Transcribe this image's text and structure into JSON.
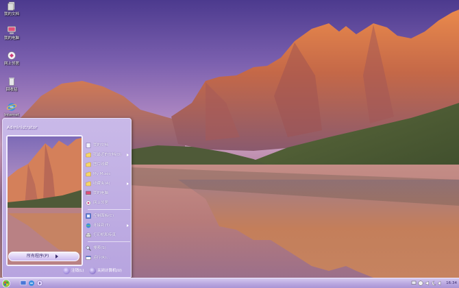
{
  "desktop": {
    "icons": [
      {
        "id": "my-documents",
        "label": "我的文档"
      },
      {
        "id": "my-computer",
        "label": "我的电脑"
      },
      {
        "id": "network-places",
        "label": "网上邻居"
      },
      {
        "id": "recycle-bin",
        "label": "回收站"
      },
      {
        "id": "internet-explorer",
        "label": "Internet"
      }
    ]
  },
  "start_menu": {
    "user_name": "Administrator",
    "all_programs_label": "所有程序(P)",
    "items": [
      {
        "label": "我的文档",
        "icon": "folder-docs-icon"
      },
      {
        "label": "我最近的文档(D)",
        "icon": "folder-recent-icon",
        "has_submenu": true
      },
      {
        "label": "图片收藏",
        "icon": "folder-pictures-icon"
      },
      {
        "label": "My Music",
        "icon": "folder-music-icon"
      },
      {
        "label": "收藏夹(A)",
        "icon": "folder-favorites-icon",
        "has_submenu": true
      },
      {
        "label": "我的电脑",
        "icon": "computer-icon"
      },
      {
        "label": "网上邻居",
        "icon": "network-icon"
      },
      {
        "label": "控制面板(C)",
        "icon": "control-panel-icon"
      },
      {
        "label": "连接到(T)",
        "icon": "connect-icon",
        "has_submenu": true
      },
      {
        "label": "打印机和传真",
        "icon": "printer-icon"
      },
      {
        "label": "搜索(S)",
        "icon": "search-icon"
      },
      {
        "label": "运行(R)...",
        "icon": "run-icon"
      }
    ],
    "footer": {
      "logoff_label": "注销(L)",
      "shutdown_label": "关闭计算机(U)"
    }
  },
  "taskbar": {
    "clock": "16:34"
  },
  "colors": {
    "menu_bg": "#c2b1e6",
    "taskbar_bg": "#b9a8e0",
    "text_dark": "#3a2a6e"
  }
}
